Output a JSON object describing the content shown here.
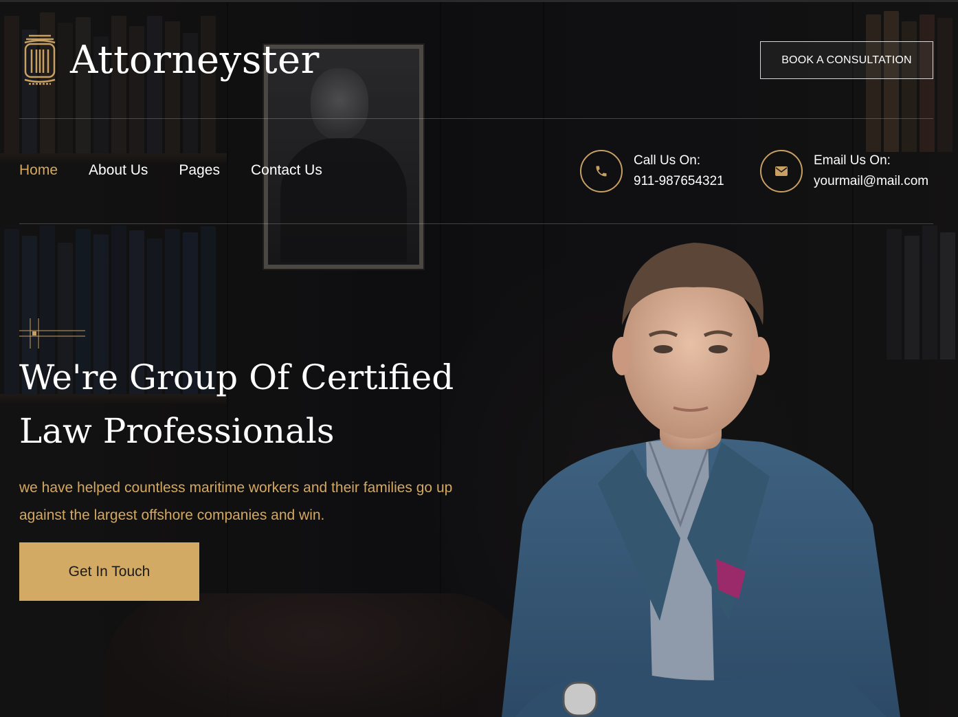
{
  "brand": {
    "name": "Attorneyster",
    "logo_icon": "pillar-icon"
  },
  "header": {
    "cta_label": "BOOK A CONSULTATION"
  },
  "nav": {
    "items": [
      {
        "label": "Home",
        "active": true
      },
      {
        "label": "About Us",
        "active": false
      },
      {
        "label": "Pages",
        "active": false
      },
      {
        "label": "Contact Us",
        "active": false
      }
    ]
  },
  "contacts": {
    "phone": {
      "icon": "phone-icon",
      "label": "Call Us On:",
      "value": "911-987654321"
    },
    "email": {
      "icon": "mail-icon",
      "label": "Email Us On:",
      "value": "yourmail@mail.com"
    }
  },
  "hero": {
    "headline_line1": "We're Group Of Certified",
    "headline_line2": "Law Professionals",
    "description": "we have helped countless maritime workers and their families go up against the largest offshore companies and win.",
    "button_label": "Get In Touch"
  },
  "colors": {
    "accent": "#d6a85e",
    "button_bg": "#d2aa64",
    "background": "#141416"
  }
}
